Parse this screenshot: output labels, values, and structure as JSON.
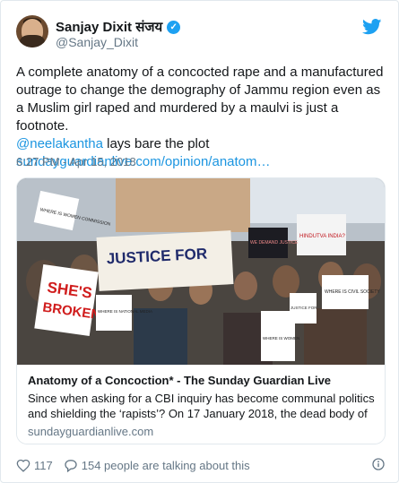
{
  "author": {
    "name": "Sanjay Dixit संजय",
    "handle": "@Sanjay_Dixit",
    "verified": true
  },
  "tweet": {
    "text": "A complete anatomy of a concocted rape and a manufactured outrage to change the demography of Jammu region even as a Muslim girl raped and murdered by a maulvi is just a footnote.",
    "mention": "@neelakantha",
    "mention_suffix": " lays bare the plot",
    "link": "sundayguardianlive.com/opinion/anatom…",
    "timestamp": "6:27 PM - Apr 15, 2018"
  },
  "link_card": {
    "image_signs": {
      "justice": "JUSTICE FOR",
      "shes_broken_line1": "SHE'S",
      "shes_broken_line2": "BROKEN.",
      "women_commission": "WHERE IS WOMEN COMMISSION",
      "national_media": "WHERE IS NATIONAL MEDIA",
      "civil_society": "WHERE IS CIVIL SOCIETY",
      "where_is_women": "WHERE IS WOMEN",
      "hindutva": "HINDUTVA INDIA?",
      "we_demand_justice": "WE DEMAND JUSTICE",
      "justice_small": "JUSTICE FOR"
    },
    "title": "Anatomy of a Concoction* - The Sunday Guardian Live",
    "description": "Since when asking for a CBI inquiry has become communal politics and shielding the ‘rapists’? On 17 January 2018, the dead body of a",
    "domain": "sundayguardianlive.com"
  },
  "actions": {
    "like_count": "117",
    "talking": "154 people are talking about this"
  },
  "colors": {
    "accent": "#1da1f2",
    "link": "#1b95e0",
    "muted": "#657786",
    "text": "#14171a",
    "border": "#e1e8ed"
  },
  "icons": [
    "verified-badge-icon",
    "twitter-bird-icon",
    "heart-icon",
    "comment-icon",
    "info-icon"
  ]
}
